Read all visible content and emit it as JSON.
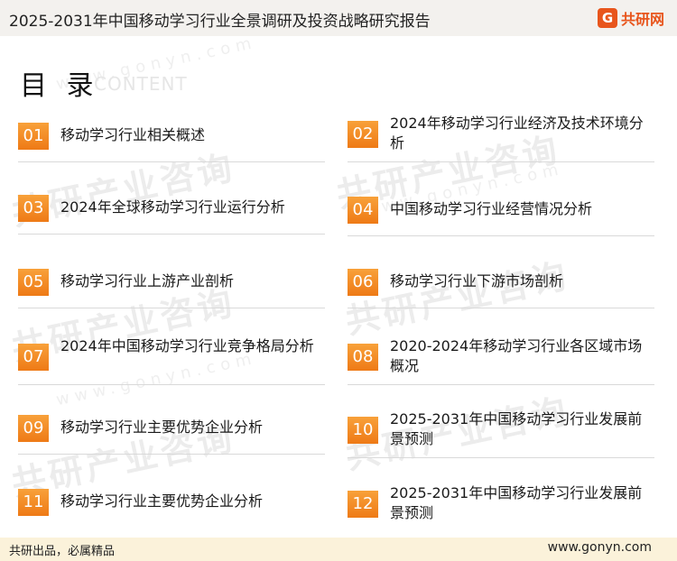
{
  "header": {
    "title": "2025-2031年中国移动学习行业全景调研及投资战略研究报告",
    "brand_mark": "G",
    "brand_name": "共研网"
  },
  "toc": {
    "heading": "目 录",
    "heading_en": "CONTENT"
  },
  "items": [
    {
      "num": "01",
      "label": "移动学习行业相关概述"
    },
    {
      "num": "02",
      "label": "2024年移动学习行业经济及技术环境分析"
    },
    {
      "num": "03",
      "label": "2024年全球移动学习行业运行分析"
    },
    {
      "num": "04",
      "label": "中国移动学习行业经营情况分析"
    },
    {
      "num": "05",
      "label": "移动学习行业上游产业剖析"
    },
    {
      "num": "06",
      "label": "移动学习行业下游市场剖析"
    },
    {
      "num": "07",
      "label": "2024年中国移动学习行业竞争格局分析"
    },
    {
      "num": "08",
      "label": "2020-2024年移动学习行业各区域市场概况"
    },
    {
      "num": "09",
      "label": "移动学习行业主要优势企业分析"
    },
    {
      "num": "10",
      "label": "2025-2031年中国移动学习行业发展前景预测"
    },
    {
      "num": "11",
      "label": "移动学习行业主要优势企业分析"
    },
    {
      "num": "12",
      "label": "2025-2031年中国移动学习行业发展前景预测"
    }
  ],
  "watermark": {
    "text": "共研产业咨询",
    "url": "www.gonyn.com"
  },
  "footer": {
    "left": "共研出品，必属精品",
    "right": "www.gonyn.com"
  },
  "colors": {
    "accent": "#ee7a16",
    "accent_light": "#f8a13a",
    "footer_bg": "#fbf2da",
    "header_bg": "#f3f1ee"
  }
}
